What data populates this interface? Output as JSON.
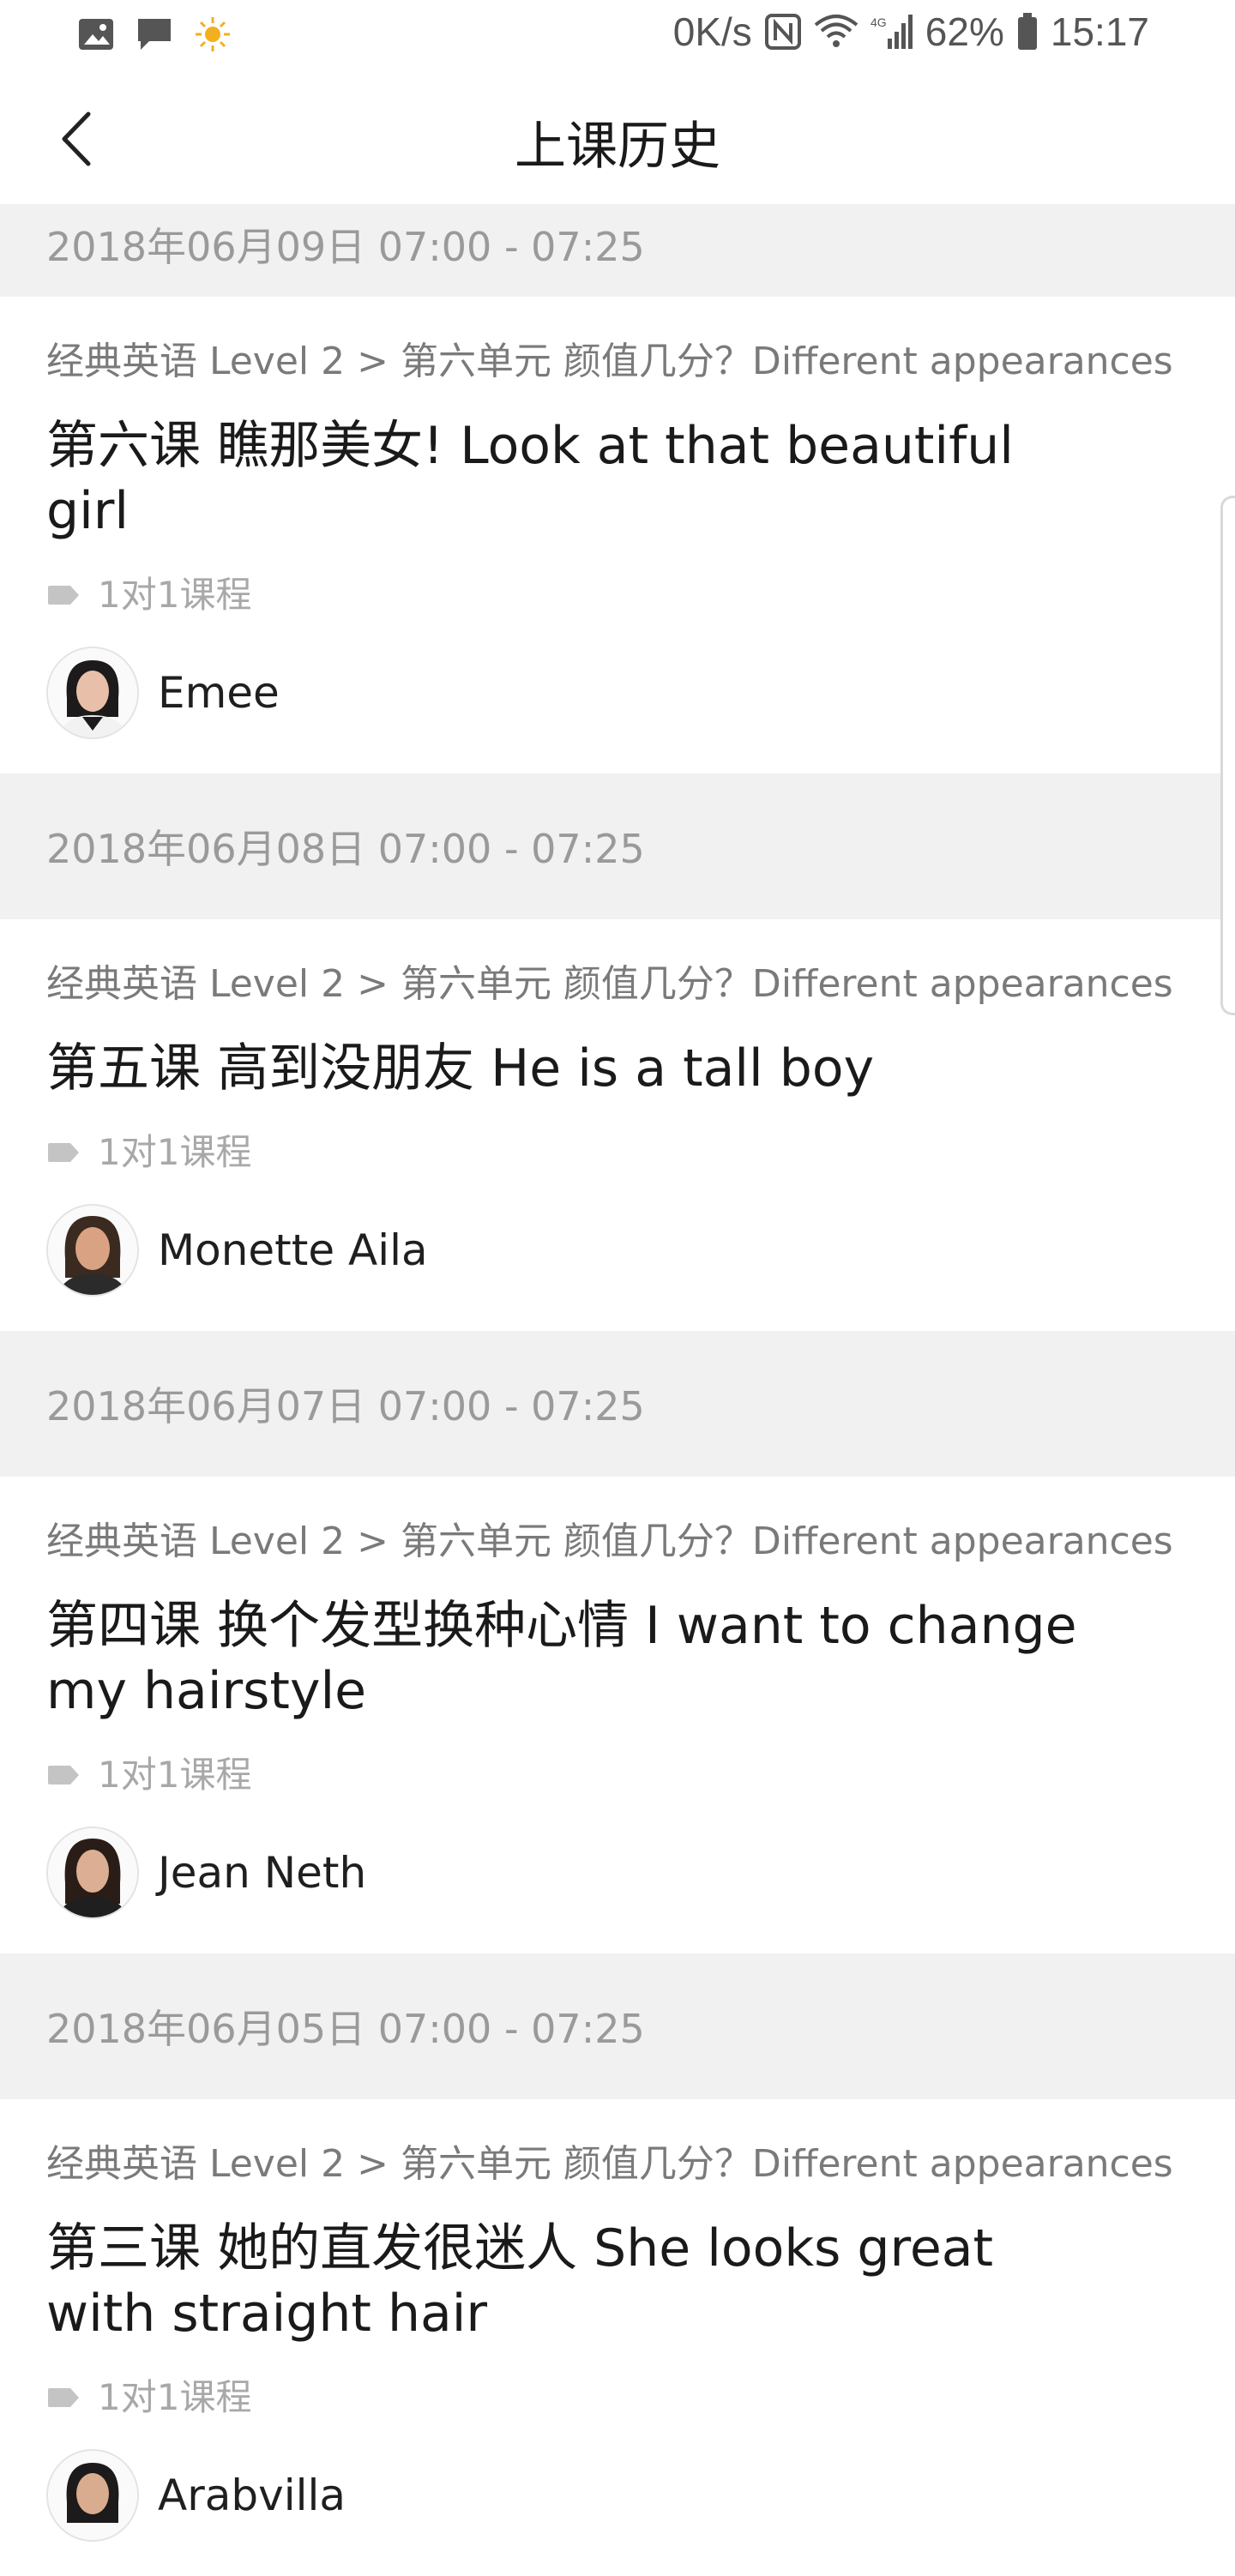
{
  "status_bar": {
    "net_speed": "0K/s",
    "battery": "62%",
    "time": "15:17",
    "left_icons": [
      "gallery-icon",
      "message-icon",
      "weather-sun-icon"
    ],
    "right_icons": [
      "nfc-icon",
      "wifi-icon",
      "signal-4g-icon",
      "battery-icon"
    ]
  },
  "header": {
    "title": "上课历史",
    "back_icon": "chevron-left-icon"
  },
  "sessions": [
    {
      "date": "2018年06月09日 07:00 - 07:25",
      "breadcrumb": "经典英语 Level 2 > 第六单元 颜值几分？Different appearances",
      "lesson": "第六课 瞧那美女! Look at that beautiful girl",
      "tag": "1对1课程",
      "teacher": "Emee"
    },
    {
      "date": "2018年06月08日 07:00 - 07:25",
      "breadcrumb": "经典英语 Level 2 > 第六单元 颜值几分？Different appearances",
      "lesson": "第五课 高到没朋友 He is a tall boy",
      "tag": "1对1课程",
      "teacher": "Monette Aila"
    },
    {
      "date": "2018年06月07日 07:00 - 07:25",
      "breadcrumb": "经典英语 Level 2 > 第六单元 颜值几分？Different appearances",
      "lesson": "第四课 换个发型换种心情 I want to change my hairstyle",
      "tag": "1对1课程",
      "teacher": "Jean Neth"
    },
    {
      "date": "2018年06月05日 07:00 - 07:25",
      "breadcrumb": "经典英语 Level 2 > 第六单元 颜值几分？Different appearances",
      "lesson": "第三课 她的直发很迷人 She looks great with straight hair",
      "tag": "1对1课程",
      "teacher": "Arabvilla"
    }
  ],
  "colors": {
    "band_bg": "#f1f1f1",
    "date_text": "#9a9a9a",
    "tag_text": "#a8a8a8"
  }
}
